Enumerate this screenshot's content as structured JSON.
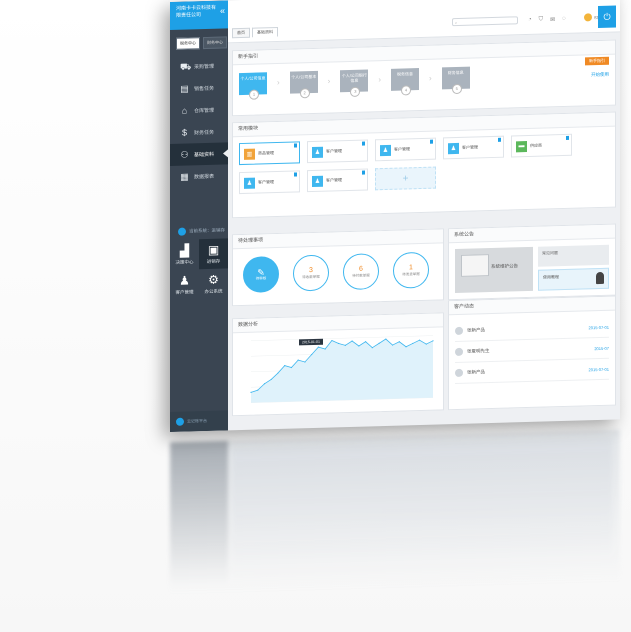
{
  "sidebar": {
    "brand_line1": "河南卡卡云科技有",
    "brand_line2": "限责任公司",
    "collapse": "«",
    "tabs": [
      "税务中心",
      "财务中心"
    ],
    "items": [
      {
        "label": "采购管理",
        "icon": "truck-icon",
        "glyph": "⛟"
      },
      {
        "label": "销售任务",
        "icon": "document-icon",
        "glyph": "▤"
      },
      {
        "label": "仓库管理",
        "icon": "home-icon",
        "glyph": "⌂"
      },
      {
        "label": "财务任务",
        "icon": "money-bag-icon",
        "glyph": "$"
      },
      {
        "label": "基础资料",
        "icon": "person-icon",
        "glyph": "⚇"
      },
      {
        "label": "数据报表",
        "icon": "report-icon",
        "glyph": "▦"
      }
    ],
    "section": "当前系统：进销存",
    "grid": [
      {
        "label": "决策中心",
        "glyph": "▟"
      },
      {
        "label": "进销存",
        "glyph": "▣"
      },
      {
        "label": "客户管理",
        "glyph": "♟"
      },
      {
        "label": "办公系统",
        "glyph": "⚙"
      }
    ],
    "footer": "云记账平台"
  },
  "topbar": {
    "tabs": [
      "首页",
      "基础资料"
    ],
    "search_placeholder": "",
    "icons": [
      "refresh-icon",
      "cart-icon",
      "message-icon",
      "bell-icon"
    ],
    "icon_glyphs": [
      "◔",
      "⛉",
      "✉",
      "◌"
    ],
    "user": "STEAM",
    "power": "⏻"
  },
  "guide": {
    "title": "新手指引",
    "tag": "新手指引",
    "steps": [
      {
        "label": "个人/公司信息",
        "n": "1"
      },
      {
        "label": "个人/公司基本",
        "n": "2"
      },
      {
        "label": "个人/公司银行信息",
        "n": "3"
      },
      {
        "label": "税务信息",
        "n": "4"
      },
      {
        "label": "财务信息",
        "n": "5"
      }
    ],
    "more": "开始使用"
  },
  "shortcuts": {
    "title": "常用模块",
    "cards": [
      {
        "label": "商品管理",
        "color": "#f1a33a",
        "glyph": "▥"
      },
      {
        "label": "客户管理",
        "color": "#3fb7ef",
        "glyph": "♟"
      },
      {
        "label": "客户管理",
        "color": "#3fb7ef",
        "glyph": "♟"
      },
      {
        "label": "客户管理",
        "color": "#3fb7ef",
        "glyph": "♟"
      },
      {
        "label": "供应商",
        "color": "#5cb85c",
        "glyph": "▬"
      },
      {
        "label": "客户管理",
        "color": "#3fb7ef",
        "glyph": "♟"
      },
      {
        "label": "客户管理",
        "color": "#3fb7ef",
        "glyph": "♟"
      }
    ],
    "add": "+"
  },
  "todo": {
    "title": "待处理事项",
    "items": [
      {
        "n": "",
        "label": "待审核"
      },
      {
        "n": "3",
        "label": "待收款单据"
      },
      {
        "n": "6",
        "label": "待付款单据"
      },
      {
        "n": "1",
        "label": "待发货单据"
      }
    ]
  },
  "notice": {
    "title": "系统公告",
    "caption": "系统维护公告",
    "side_top": "常见问题",
    "side_bot": "使用教程"
  },
  "chart": {
    "title": "数据分析",
    "tip": "2015-01-01",
    "chart_data": {
      "type": "area",
      "x": [
        1,
        2,
        3,
        4,
        5,
        6,
        7,
        8,
        9,
        10,
        11,
        12,
        13,
        14,
        15,
        16,
        17,
        18,
        19,
        20,
        21,
        22,
        23,
        24,
        25,
        26,
        27,
        28
      ],
      "values": [
        10,
        12,
        18,
        22,
        28,
        35,
        33,
        40,
        38,
        45,
        52,
        50,
        58,
        55,
        53,
        57,
        52,
        56,
        50,
        54,
        58,
        52,
        55,
        50,
        53,
        56,
        52,
        55
      ],
      "ylim": [
        0,
        60
      ]
    }
  },
  "activities": {
    "title": "客户动态",
    "rows": [
      {
        "name": "张新产品",
        "meta": "2015-07-01"
      },
      {
        "name": "张夏明先生",
        "meta": "2015-07"
      },
      {
        "name": "张新产品",
        "meta": "2015-07-01"
      }
    ]
  }
}
